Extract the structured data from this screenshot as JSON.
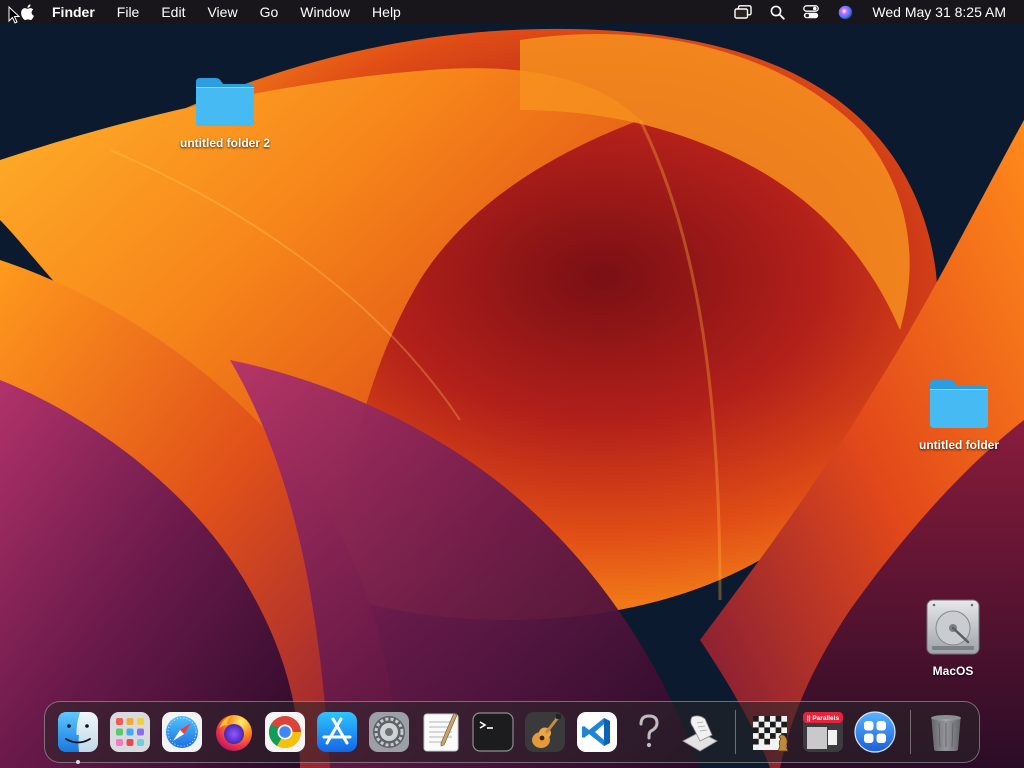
{
  "menubar": {
    "apple_icon": "apple-logo-icon",
    "app_name": "Finder",
    "menus": [
      "File",
      "Edit",
      "View",
      "Go",
      "Window",
      "Help"
    ],
    "status_icons": [
      "screen-mirroring-icon",
      "spotlight-search-icon",
      "control-center-icon",
      "siri-icon"
    ],
    "clock": "Wed May 31  8:25 AM"
  },
  "desktop": {
    "icons": [
      {
        "label": "untitled folder 2",
        "icon": "folder-icon"
      },
      {
        "label": "untitled folder",
        "icon": "folder-icon"
      },
      {
        "label": "MacOS",
        "icon": "hard-drive-icon"
      }
    ]
  },
  "dock": {
    "apps": [
      {
        "name": "Finder",
        "icon": "finder-icon",
        "running": true
      },
      {
        "name": "Launchpad",
        "icon": "launchpad-icon",
        "running": false
      },
      {
        "name": "Safari",
        "icon": "safari-icon",
        "running": false
      },
      {
        "name": "Firefox",
        "icon": "firefox-icon",
        "running": false
      },
      {
        "name": "Google Chrome",
        "icon": "chrome-icon",
        "running": false
      },
      {
        "name": "App Store",
        "icon": "app-store-icon",
        "running": false
      },
      {
        "name": "System Preferences",
        "icon": "system-preferences-icon",
        "running": false
      },
      {
        "name": "TextEdit",
        "icon": "textedit-icon",
        "running": false
      },
      {
        "name": "Terminal",
        "icon": "terminal-icon",
        "running": false
      },
      {
        "name": "GarageBand",
        "icon": "garageband-icon",
        "running": false
      },
      {
        "name": "Visual Studio Code",
        "icon": "vscode-icon",
        "running": false
      },
      {
        "name": "Unknown App",
        "icon": "question-mark-icon",
        "running": false
      },
      {
        "name": "Script Editor",
        "icon": "script-editor-icon",
        "running": false
      }
    ],
    "extras": [
      {
        "name": "Chess",
        "icon": "chess-icon"
      },
      {
        "name": "Parallels",
        "icon": "parallels-icon",
        "badge": "|| Parallels"
      },
      {
        "name": "Parallels Apps",
        "icon": "apps-grid-icon"
      }
    ],
    "trash": {
      "name": "Trash",
      "icon": "trash-icon"
    }
  },
  "colors": {
    "wallpaper_dark": "#0b1a2e",
    "wallpaper_orange": "#f37a12",
    "wallpaper_red": "#c0281a",
    "wallpaper_purple": "#5a1a4a",
    "folder_blue": "#3fb4f0"
  }
}
